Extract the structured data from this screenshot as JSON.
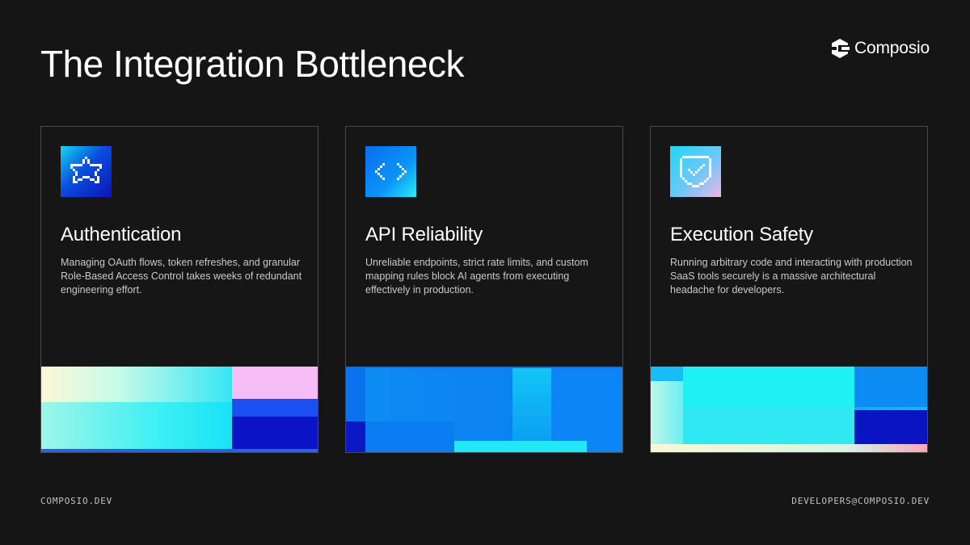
{
  "slide": {
    "title": "The Integration Bottleneck"
  },
  "brand": {
    "name": "Composio",
    "icon": "composio-logo-icon"
  },
  "cards": [
    {
      "icon": "star-icon",
      "title": "Authentication",
      "text": "Managing OAuth flows, token refreshes, and granular Role-Based Access Control takes weeks of redundant engineering effort."
    },
    {
      "icon": "code-brackets-icon",
      "title": "API Reliability",
      "text": "Unreliable endpoints, strict rate limits, and custom mapping rules block AI agents from executing effectively in production."
    },
    {
      "icon": "shield-check-icon",
      "title": "Execution Safety",
      "text": "Running arbitrary code and interacting with production SaaS tools securely is a massive architectural headache for developers."
    }
  ],
  "footer": {
    "website": "COMPOSIO.DEV",
    "email": "DEVELOPERS@COMPOSIO.DEV"
  },
  "colors": {
    "background": "#151515",
    "card_border": "#4a4a4a",
    "accent_cyan": "#22f0f0",
    "accent_blue": "#0a8cff",
    "accent_navy": "#0b1fc4",
    "accent_pink": "#f6b8f4"
  }
}
